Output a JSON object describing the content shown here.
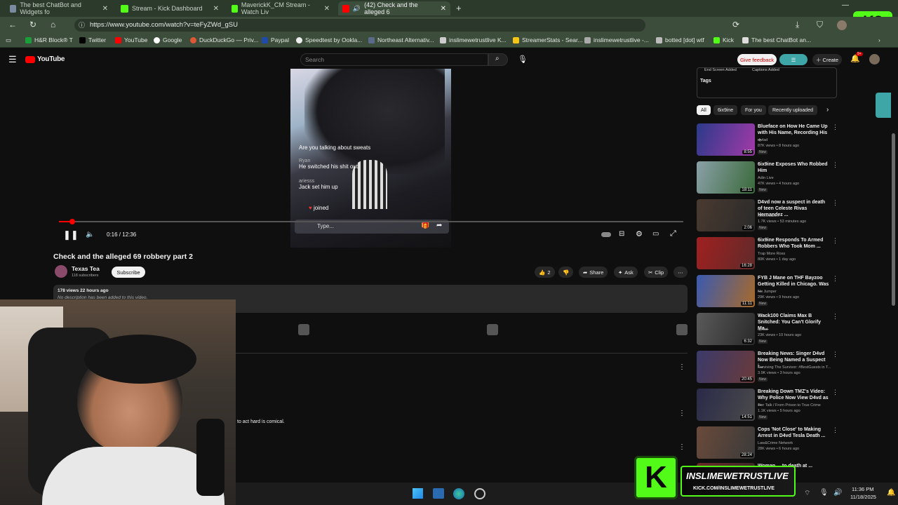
{
  "browser": {
    "tabs": [
      {
        "title": "The best ChatBot and Widgets fo",
        "favcolor": "#7a8aa0",
        "active": false
      },
      {
        "title": "Stream - Kick Dashboard",
        "favcolor": "#53fc18",
        "active": false
      },
      {
        "title": "MaverickK_CM Stream - Watch Liv",
        "favcolor": "#53fc18",
        "active": false
      },
      {
        "title": "(42) Check and the alleged 6",
        "favcolor": "#ff0000",
        "active": true
      }
    ],
    "url": "https://www.youtube.com/watch?v=teFyZWd_gSU",
    "bookmarks": [
      {
        "label": "H&R Block® T",
        "color": "#1a9e3a"
      },
      {
        "label": "Twitter",
        "color": "#000000"
      },
      {
        "label": "YouTube",
        "color": "#ff0000"
      },
      {
        "label": "Google",
        "color": "#ffffff"
      },
      {
        "label": "DuckDuckGo — Priv...",
        "color": "#de5833"
      },
      {
        "label": "Paypal",
        "color": "#1f4aa8"
      },
      {
        "label": "Speedtest by Ookla...",
        "color": "#eeeeee"
      },
      {
        "label": "Northeast Alternativ...",
        "color": "#5a6b8a"
      },
      {
        "label": "inslimewetrustlive K...",
        "color": "#cccccc"
      },
      {
        "label": "StreamerStats - Sear...",
        "color": "#f5c518"
      },
      {
        "label": "inslimewetrustlive -...",
        "color": "#aaaaaa"
      },
      {
        "label": "botted [dot] wtf",
        "color": "#bbbbbb"
      },
      {
        "label": "Kick",
        "color": "#53fc18"
      },
      {
        "label": "The best ChatBot an...",
        "color": "#dddddd"
      }
    ]
  },
  "youtube": {
    "logo": "YouTube",
    "search_placeholder": "Search",
    "feedback": "Give feedback",
    "create": "Create",
    "notif_count": "9+",
    "player": {
      "time": "0:16 / 12:36",
      "progress": 0.021,
      "chat": [
        {
          "user": "",
          "text": "Are you talking about sweats"
        },
        {
          "user": "Ryan",
          "text": "He switched his shit out"
        },
        {
          "user": "ariesss",
          "text": "Jack set him up"
        },
        {
          "user": "",
          "text": "joined"
        }
      ],
      "chat_input": "Type..."
    },
    "video_title": "Check and the alleged 69 robbery part 2",
    "channel": {
      "name": "Texas Tea",
      "subs": "118 subscribers",
      "subscribe": "Subscribe"
    },
    "actions": {
      "likes": "2",
      "share": "Share",
      "ask": "Ask",
      "clip": "Clip"
    },
    "description": {
      "meta": "178 views  22 hours ago",
      "text": "No description has been added to this video."
    },
    "comment_snippet": "to act hard is comical.",
    "right": {
      "tags_header_items": [
        "End Screen Added",
        "Captions Added"
      ],
      "tags_label": "Tags",
      "chips": [
        "All",
        "6ix9ine",
        "For you",
        "Recently uploaded"
      ],
      "recs": [
        {
          "title": "Blueface on How He Came Up with His Name, Recording His ...",
          "channel": "djvlad",
          "views": "87K views • 8 hours ago",
          "dur": "8:55",
          "badge": "New",
          "c1": "#2b3a8a",
          "c2": "#a23aa8"
        },
        {
          "title": "6ix9ine Exposes Who Robbed Him",
          "channel": "Adin Live",
          "views": "47K views • 4 hours ago",
          "dur": "18:11",
          "badge": "New",
          "c1": "#8aa0a8",
          "c2": "#3a6a3a"
        },
        {
          "title": "D4vd now a suspect in death of teen Celeste Rivas Hernandez ...",
          "channel": "NewsNation",
          "views": "1.7K views • 53 minutes ago",
          "dur": "2:06",
          "badge": "New",
          "c1": "#4a3a30",
          "c2": "#2a2a2a"
        },
        {
          "title": "6ix9ine Responds To Armed Robbers Who Took Mom ...",
          "channel": "Trap More Ross",
          "views": "80K views • 1 day ago",
          "dur": "16:28",
          "badge": "",
          "c1": "#a02020",
          "c2": "#602a2a"
        },
        {
          "title": "FYB J Mane on THF Bayzoo Getting Killed in Chicago. Was ...",
          "channel": "No Jumper",
          "views": "29K views • 9 hours ago",
          "dur": "11:11",
          "badge": "New",
          "c1": "#3a5ab0",
          "c2": "#a86a2a"
        },
        {
          "title": "Wack100 Claims Max B Snitched: You Can't Glorify Ma...",
          "channel": "djvlad",
          "views": "23K views • 10 hours ago",
          "dur": "6:32",
          "badge": "New",
          "c1": "#5a5a5a",
          "c2": "#2a2a2a"
        },
        {
          "title": "Breaking News: Singer D4vd Now Being Named a Suspect i...",
          "channel": "Surviving The Survivor: #BestGuests in T...",
          "views": "3.9K views • 3 hours ago",
          "dur": "20:45",
          "badge": "New",
          "c1": "#3a3a6a",
          "c2": "#6a3a3a"
        },
        {
          "title": "Breaking Down TMZ's Video: Why Police Now View D4vd as ...",
          "channel": "Tier Talk / From Prison to True Crime",
          "views": "1.1K views • 5 hours ago",
          "dur": "14:51",
          "badge": "New",
          "c1": "#2a2a4a",
          "c2": "#4a4a4a"
        },
        {
          "title": "Cops 'Not Close' to Making Arrest in D4vd Tesla Death ...",
          "channel": "Law&Crime Network",
          "views": "28K views • 6 hours ago",
          "dur": "28:24",
          "badge": "",
          "c1": "#6a4a3a",
          "c2": "#3a3a3a"
        },
        {
          "title": "Woman ... to death at ... County, c...",
          "channel": "",
          "views": "",
          "dur": "",
          "badge": "",
          "c1": "#6a2a2a",
          "c2": "#3a2a2a"
        }
      ]
    }
  },
  "overlay": {
    "kick_name": "INSLIMEWETRUSTLIVE",
    "kick_url": "KICK.COM/INSLIMEWETRUSTLIVE"
  },
  "taskbar": {
    "time": "11:36 PM",
    "date": "11/18/2025"
  }
}
